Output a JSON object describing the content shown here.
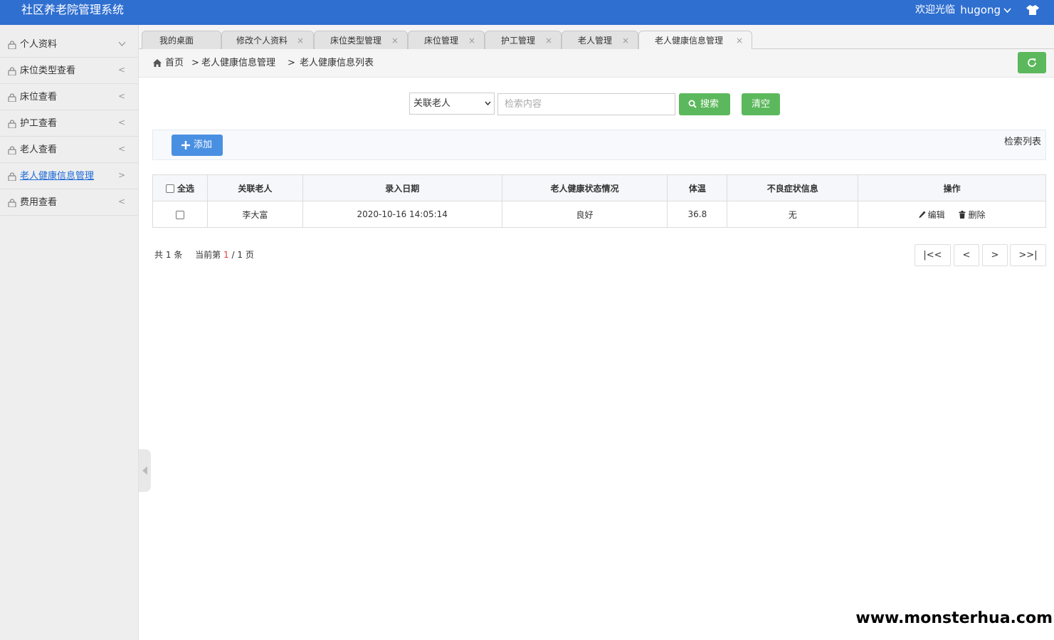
{
  "header": {
    "title": "社区养老院管理系统",
    "welcome": "欢迎光临",
    "username": "hugong"
  },
  "sidebar": {
    "items": [
      {
        "label": "个人资料",
        "arrow": "chevron"
      },
      {
        "label": "床位类型查看",
        "arrow": "<"
      },
      {
        "label": "床位查看",
        "arrow": "<"
      },
      {
        "label": "护工查看",
        "arrow": "<"
      },
      {
        "label": "老人查看",
        "arrow": "<"
      },
      {
        "label": "老人健康信息管理",
        "arrow": ">"
      },
      {
        "label": "费用查看",
        "arrow": "<"
      }
    ]
  },
  "tabs": [
    {
      "label": "我的桌面",
      "closable": false
    },
    {
      "label": "修改个人资料",
      "closable": true
    },
    {
      "label": "床位类型管理",
      "closable": true
    },
    {
      "label": "床位管理",
      "closable": true
    },
    {
      "label": "护工管理",
      "closable": true
    },
    {
      "label": "老人管理",
      "closable": true
    },
    {
      "label": "老人健康信息管理",
      "closable": true
    }
  ],
  "tab_close_glyph": "×",
  "breadcrumb": {
    "home": "首页",
    "sep": ">",
    "level1": "老人健康信息管理",
    "level2": "老人健康信息列表"
  },
  "search": {
    "field_selected": "关联老人",
    "placeholder": "检索内容",
    "search_label": "搜索",
    "clear_label": "清空"
  },
  "toolbar": {
    "add_label": "添加",
    "list_title": "检索列表"
  },
  "table": {
    "select_all": "全选",
    "columns": [
      "关联老人",
      "录入日期",
      "老人健康状态情况",
      "体温",
      "不良症状信息",
      "操作"
    ],
    "rows": [
      {
        "elder": "李大富",
        "date": "2020-10-16 14:05:14",
        "status": "良好",
        "temperature": "36.8",
        "symptoms": "无",
        "edit": "编辑",
        "delete": "删除"
      }
    ]
  },
  "pager": {
    "total_prefix": "共",
    "total": "1",
    "total_suffix": "条",
    "current_prefix": "当前第",
    "current": "1",
    "slash": "/",
    "pages": "1",
    "pages_suffix": "页",
    "first": "|<<",
    "prev": "<",
    "next": ">",
    "last": ">>|"
  },
  "watermark": "www.monsterhua.com",
  "colors": {
    "header": "#2f6fd0",
    "green": "#5cb85c",
    "blue_button": "#4a90e2",
    "active_link": "#1d6ad7"
  }
}
